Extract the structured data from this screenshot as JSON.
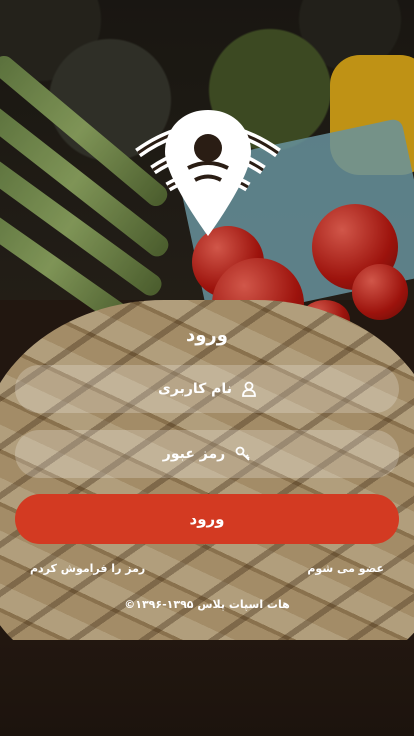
{
  "login": {
    "title": "ورود",
    "username": {
      "placeholder": "نام کاربری",
      "icon": "user-icon"
    },
    "password": {
      "placeholder": "رمز عبور",
      "icon": "key-icon"
    },
    "submit_label": "ورود"
  },
  "links": {
    "register": "عضو می شوم",
    "forgot_password": "رمز را فراموش کردم"
  },
  "footer": {
    "copyright": "©۱۳۹۶-۱۳۹۵ هات اسپات پلاس"
  },
  "colors": {
    "accent": "#d33a22",
    "field_bg": "rgba(255,255,255,0.22)",
    "text": "#ffffff"
  }
}
